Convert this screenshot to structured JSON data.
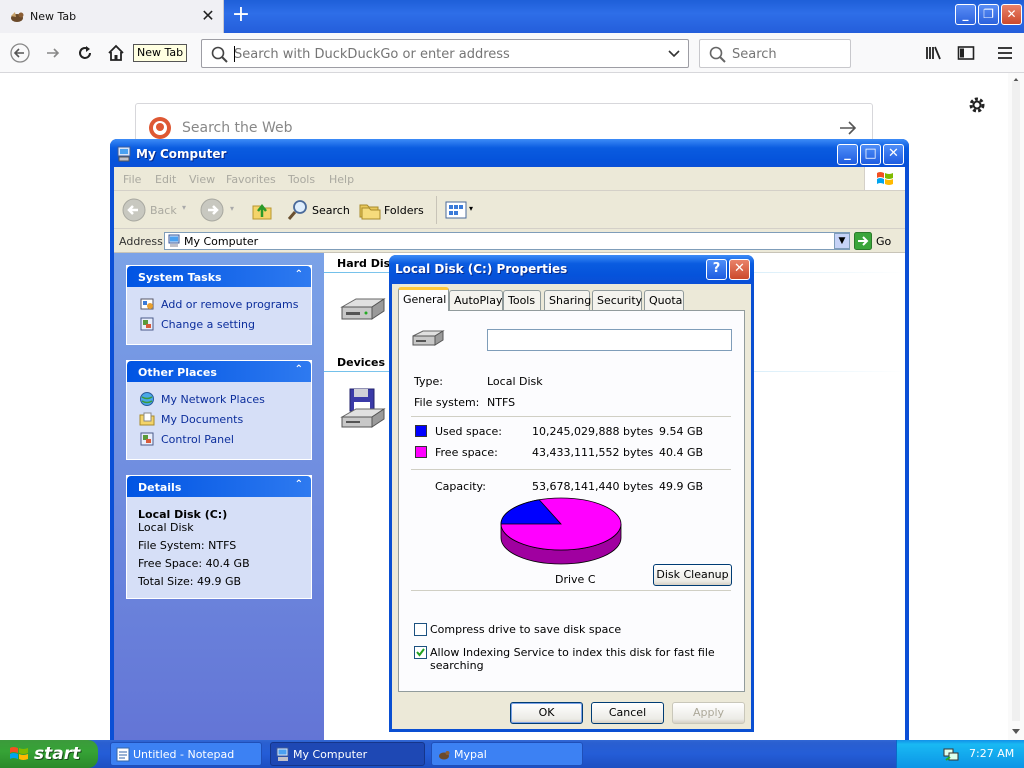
{
  "browser": {
    "tab_title": "New Tab",
    "tooltip": "New Tab",
    "url_placeholder": "Search with DuckDuckGo or enter address",
    "search_placeholder": "Search",
    "ddg_placeholder": "Search the Web"
  },
  "mycomputer": {
    "title": "My Computer",
    "menu": [
      "File",
      "Edit",
      "View",
      "Favorites",
      "Tools",
      "Help"
    ],
    "toolbar": {
      "back": "Back",
      "search": "Search",
      "folders": "Folders"
    },
    "address_label": "Address",
    "address_value": "My Computer",
    "go_label": "Go",
    "system_tasks": {
      "title": "System Tasks",
      "items": [
        "Add or remove programs",
        "Change a setting"
      ]
    },
    "other_places": {
      "title": "Other Places",
      "items": [
        "My Network Places",
        "My Documents",
        "Control Panel"
      ]
    },
    "details": {
      "title": "Details",
      "name": "Local Disk (C:)",
      "type": "Local Disk",
      "fs": "File System: NTFS",
      "free": "Free Space: 40.4 GB",
      "total": "Total Size: 49.9 GB"
    },
    "section_hard_disks": "Hard Disk",
    "section_devices": "Devices w"
  },
  "properties": {
    "title": "Local Disk (C:) Properties",
    "tabs": [
      "General",
      "AutoPlay",
      "Tools",
      "Sharing",
      "Security",
      "Quota"
    ],
    "type_label": "Type:",
    "type_value": "Local Disk",
    "fs_label": "File system:",
    "fs_value": "NTFS",
    "used_label": "Used space:",
    "used_bytes": "10,245,029,888 bytes",
    "used_gb": "9.54 GB",
    "free_label": "Free space:",
    "free_bytes": "43,433,111,552 bytes",
    "free_gb": "40.4 GB",
    "capacity_label": "Capacity:",
    "capacity_bytes": "53,678,141,440 bytes",
    "capacity_gb": "49.9 GB",
    "drive_label": "Drive C",
    "disk_cleanup": "Disk Cleanup",
    "compress_label": "Compress drive to save disk space",
    "index_label": "Allow Indexing Service to index this disk for fast file searching",
    "ok": "OK",
    "cancel": "Cancel",
    "apply": "Apply",
    "used_fraction": 0.1909,
    "used_color": "#0000ff",
    "free_color": "#ff00ff"
  },
  "taskbar": {
    "start": "start",
    "tasks": [
      "Untitled - Notepad",
      "My Computer",
      "Mypal"
    ],
    "clock": "7:27 AM"
  }
}
